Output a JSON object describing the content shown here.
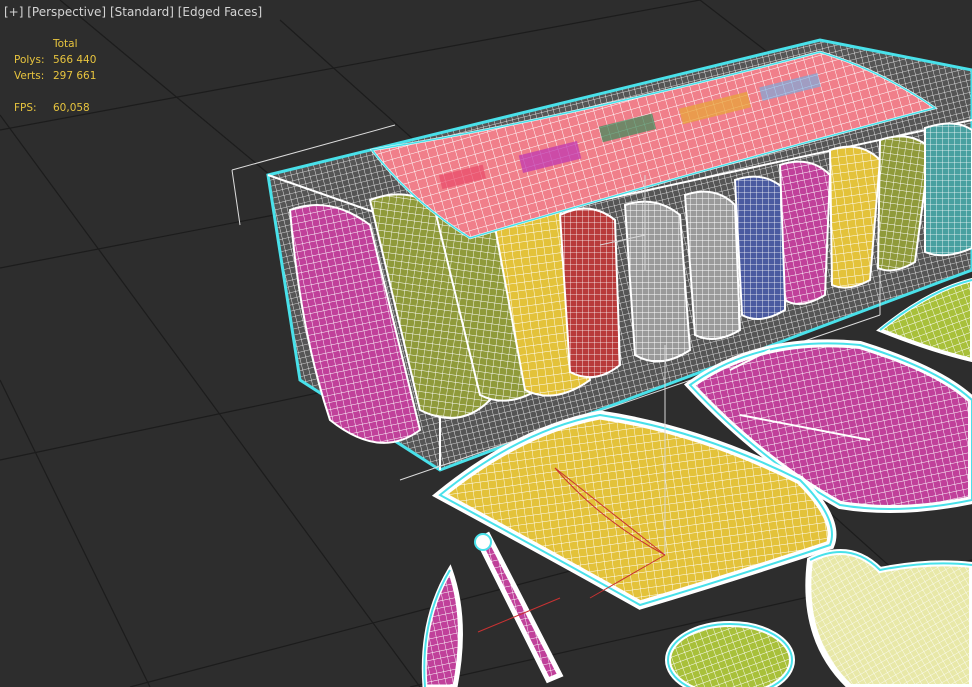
{
  "viewport": {
    "labels": [
      "[+]",
      "[Perspective]",
      "[Standard]",
      "[Edged Faces]"
    ]
  },
  "stats": {
    "header": "Total",
    "polys_label": "Polys:",
    "polys_value": "566 440",
    "verts_label": "Verts:",
    "verts_value": "297 661",
    "fps_label": "FPS:",
    "fps_value": "60,058"
  },
  "colors": {
    "background": "#2d2d2d",
    "grid": "#1e1e1e",
    "selection_outline": "#49e1ea",
    "wire": "#ffffff",
    "stats_text": "#e7c43e",
    "label_text": "#d4d4d4",
    "bag_magenta": "#c0409a",
    "bag_olive": "#8f9a3a",
    "bag_yellow": "#e3c23a",
    "bag_red": "#b83a3a",
    "bag_blue": "#4a5aa0",
    "bag_teal": "#48a0a0",
    "bag_lime": "#a8c03a",
    "bag_cream": "#e8e8a8",
    "axis_red": "#c83232"
  },
  "scene": {
    "objects": [
      {
        "name": "crate-box",
        "kind": "container"
      },
      {
        "name": "lid-cloth",
        "kind": "cloth"
      },
      {
        "name": "bag-magenta-left",
        "color": "bag_magenta"
      },
      {
        "name": "bag-olive",
        "color": "bag_olive"
      },
      {
        "name": "bag-olive-2",
        "color": "bag_olive"
      },
      {
        "name": "bag-yellow-front",
        "color": "bag_yellow"
      },
      {
        "name": "bag-red",
        "color": "bag_red"
      },
      {
        "name": "bag-white",
        "color": "wire"
      },
      {
        "name": "bag-blue",
        "color": "bag_blue"
      },
      {
        "name": "bag-magenta-back",
        "color": "bag_magenta"
      },
      {
        "name": "bag-yellow-back",
        "color": "bag_yellow"
      },
      {
        "name": "bag-teal",
        "color": "bag_teal"
      },
      {
        "name": "bag-magenta-floor",
        "color": "bag_magenta"
      },
      {
        "name": "bag-yellow-floor",
        "color": "bag_yellow"
      },
      {
        "name": "bag-lime-floor",
        "color": "bag_lime"
      },
      {
        "name": "bowl-lime",
        "color": "bag_lime"
      },
      {
        "name": "cloth-cream",
        "color": "bag_cream"
      },
      {
        "name": "leaf-magenta",
        "color": "bag_magenta"
      },
      {
        "name": "stick-pink",
        "color": "bag_magenta"
      }
    ]
  }
}
